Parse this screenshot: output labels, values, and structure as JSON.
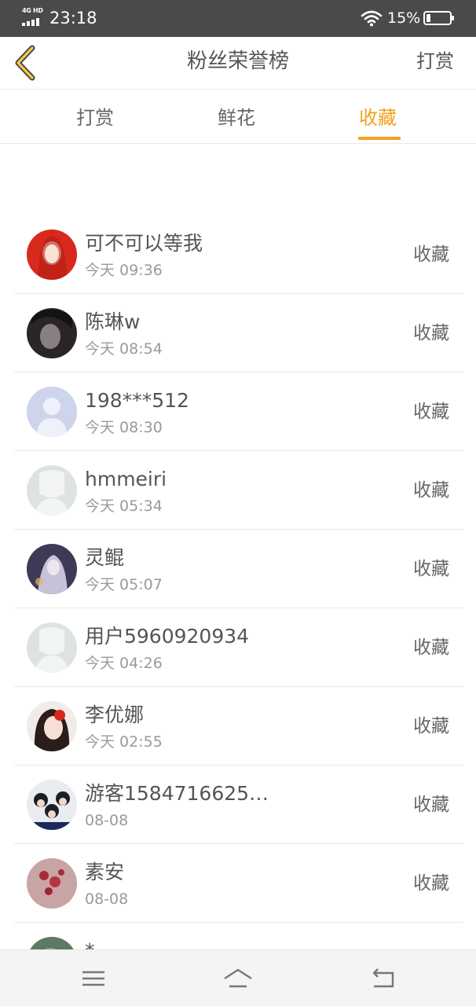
{
  "status_bar": {
    "network": "4G HD",
    "time": "23:18",
    "battery": "15%",
    "icons": [
      "signal-icon",
      "wifi-icon",
      "battery-icon"
    ]
  },
  "header": {
    "title": "粉丝荣誉榜",
    "right_action": "打赏",
    "back_icon": "chevron-left-icon"
  },
  "tabs": [
    {
      "label": "打赏",
      "active": false
    },
    {
      "label": "鲜花",
      "active": false
    },
    {
      "label": "收藏",
      "active": true
    }
  ],
  "colors": {
    "accent": "#f0a21e",
    "status_bar": "#4a4a4a",
    "text_primary": "#555555",
    "text_secondary": "#9a9a9a"
  },
  "fans": [
    {
      "name": "可不可以等我",
      "time": "今天 09:36",
      "type": "收藏"
    },
    {
      "name": "陈琳w",
      "time": "今天 08:54",
      "type": "收藏"
    },
    {
      "name": "198***512",
      "time": "今天 08:30",
      "type": "收藏"
    },
    {
      "name": "hmmeiri",
      "time": "今天 05:34",
      "type": "收藏"
    },
    {
      "name": "灵鲲",
      "time": "今天 05:07",
      "type": "收藏"
    },
    {
      "name": "用户5960920934",
      "time": "今天 04:26",
      "type": "收藏"
    },
    {
      "name": "李优娜",
      "time": "今天 02:55",
      "type": "收藏"
    },
    {
      "name": "游客1584716625…",
      "time": "08-08",
      "type": "收藏"
    },
    {
      "name": "素安",
      "time": "08-08",
      "type": "收藏"
    },
    {
      "name": "*",
      "time": "",
      "type": ""
    }
  ],
  "navbar": {
    "icons": [
      "menu-icon",
      "home-icon",
      "back-icon"
    ]
  }
}
